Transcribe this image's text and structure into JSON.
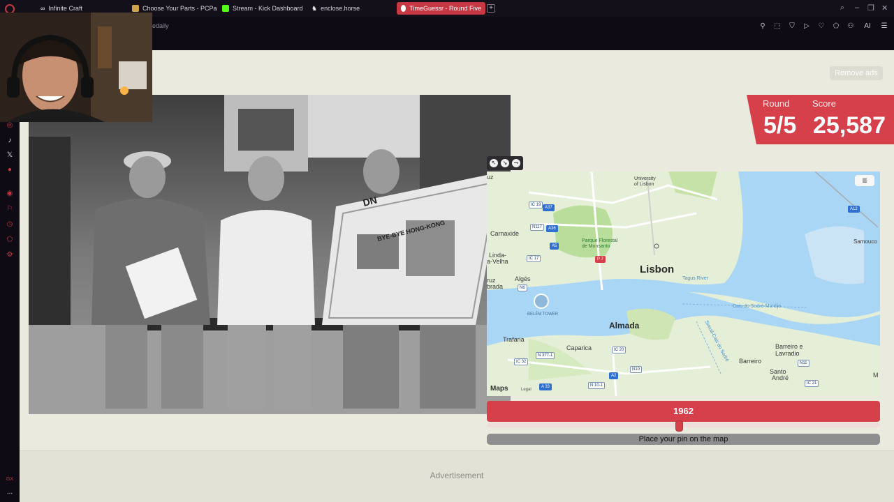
{
  "browser": {
    "tabs": [
      {
        "title": "Infinite Craft",
        "active": false
      },
      {
        "title": "Choose Your Parts - PCPa",
        "active": false
      },
      {
        "title": "Stream - Kick Dashboard",
        "active": false
      },
      {
        "title": "enclose.horse",
        "active": false
      },
      {
        "title": "TimeGuessr - Round Five",
        "active": true
      }
    ],
    "new_tab_label": "+",
    "address_fragment": "edaily",
    "toolbar_ai_label": "AI",
    "accent": "#c73844"
  },
  "sidebar": {
    "footer_label": "GX",
    "more_label": "..."
  },
  "page": {
    "remove_ads_label": "Remove ads",
    "advertisement_label": "Advertisement"
  },
  "score_panel": {
    "round_label": "Round",
    "score_label": "Score",
    "round_value": "5/5",
    "score_value": "25,587",
    "color": "#d6404b"
  },
  "map": {
    "labels": {
      "lisbon": "Lisbon",
      "almada": "Almada",
      "carnaxide": "Carnaxide",
      "linda": "Linda-",
      "avelha": "a-Velha",
      "alges": "Algés",
      "ruz": "ruz",
      "brada": "brada",
      "trafaria": "Trafaria",
      "caparica": "Caparica",
      "barreiro": "Barreiro",
      "barreiro_lavradio_1": "Barreiro e",
      "barreiro_lavradio_2": "Lavradio",
      "santo_andre_1": "Santo",
      "santo_andre_2": "André",
      "samouco": "Samouco",
      "uni_1": "University",
      "uni_2": "of Lisbon",
      "parque_1": "Parque Florestal",
      "parque_2": "de Monsanto",
      "belem_tower": "BELÉM TOWER",
      "tagus": "Tagus River",
      "cais": "Cais do Sodré-Montijo",
      "seixal": "Seixal-Cais do Sodré",
      "edge_uz": "uz",
      "edge_m": "M"
    },
    "shields": {
      "ic19": "IC 19",
      "a37": "A37",
      "n117": "N117",
      "a36": "A36",
      "a5": "A5",
      "ic17": "IC 17",
      "n6": "N6",
      "ic20": "IC 20",
      "n3771": "N 377-1",
      "ic32": "IC 32",
      "n10": "N10",
      "a2": "A2",
      "a33": "A 33",
      "n101": "N 10-1",
      "a12": "A12",
      "n11": "N11",
      "ic21": "IC 21",
      "p7": "P 7"
    },
    "maps_logo": "Maps",
    "legal": "Legal",
    "colors": {
      "water": "#a9d6f5",
      "land": "#e5efd8",
      "park": "#b9dd9a"
    }
  },
  "year_slider": {
    "year": "1962",
    "place_pin_label": "Place your pin on the map",
    "fill": 0.49
  },
  "photo": {
    "newspaper_headline": "BYE-BYE HONG-KONG",
    "masthead": "DN"
  }
}
